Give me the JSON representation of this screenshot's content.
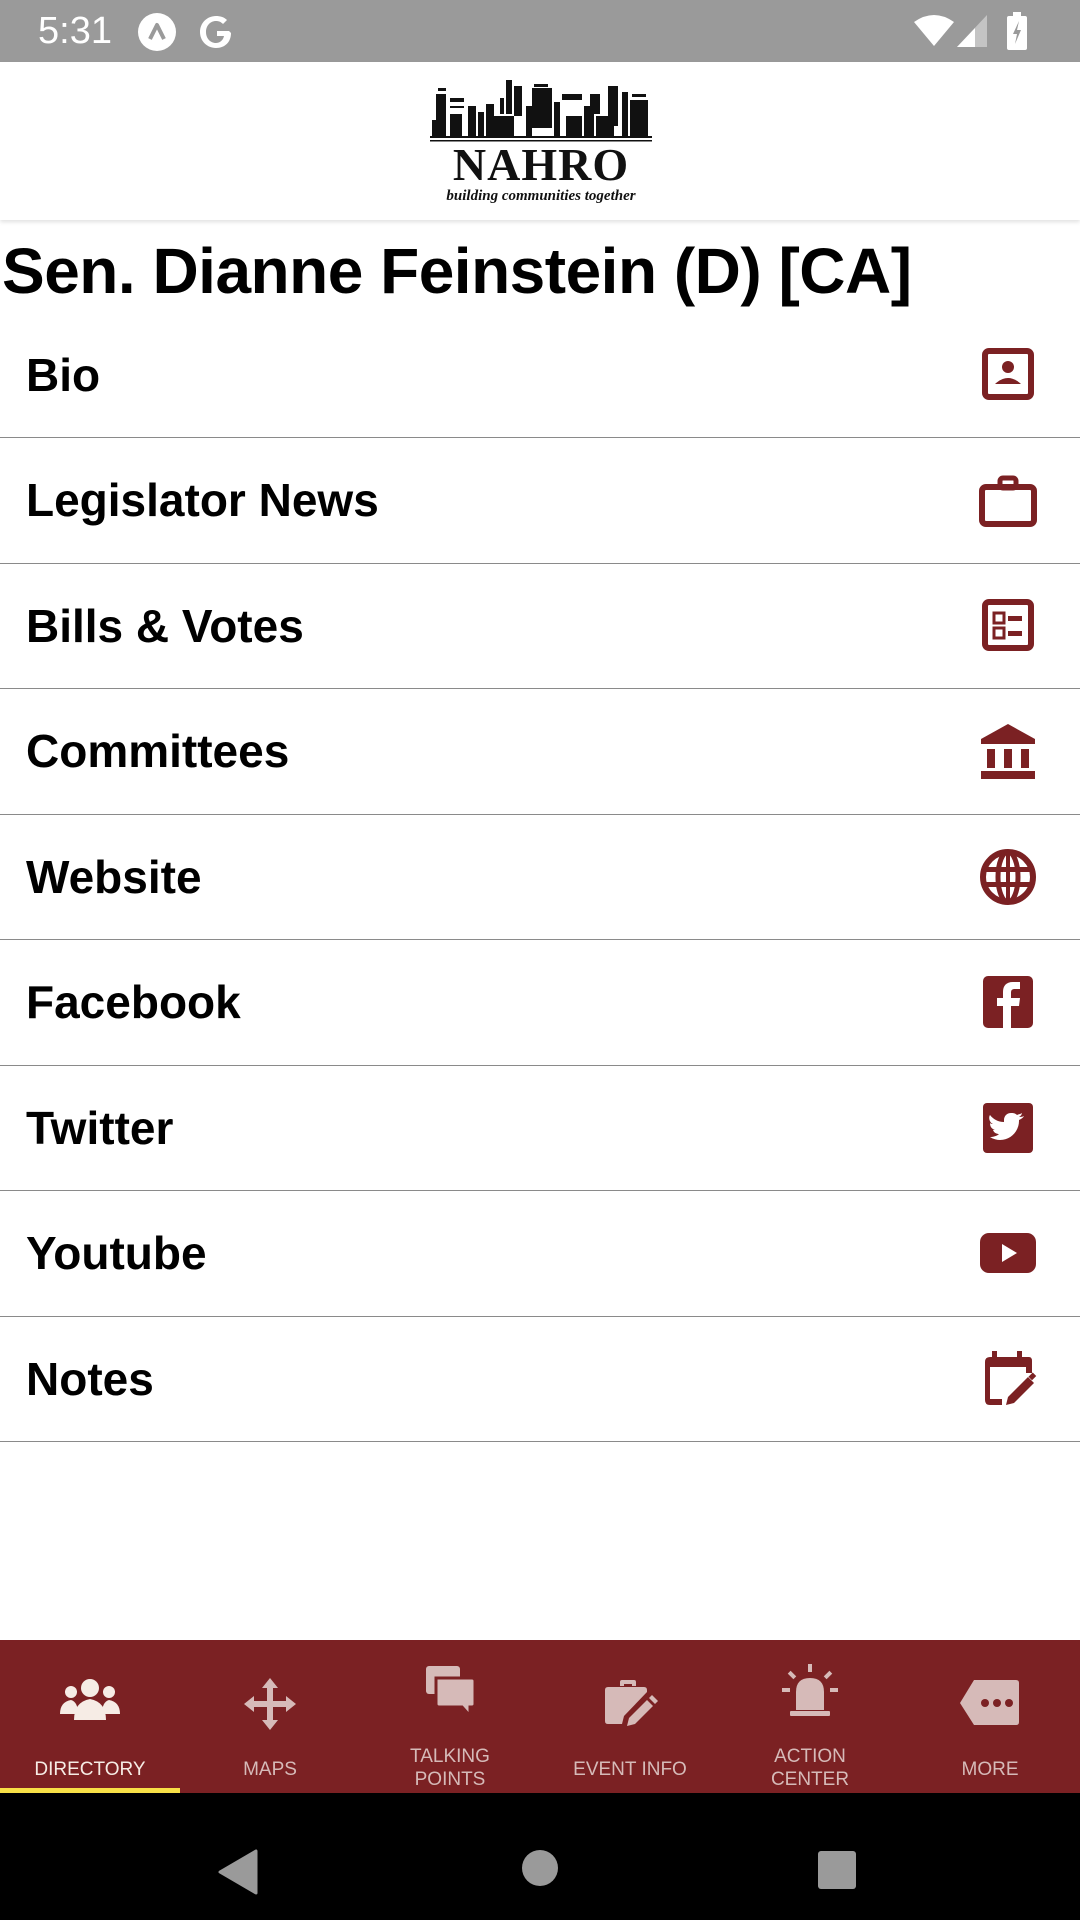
{
  "status_bar": {
    "time": "5:31",
    "icons": [
      "app-notification-icon",
      "google-icon",
      "wifi-icon",
      "cellular-signal-icon",
      "battery-charging-icon"
    ]
  },
  "header": {
    "logo_name": "NAHRO",
    "logo_tagline": "building communities together"
  },
  "page": {
    "title": "Sen. Dianne Feinstein (D) [CA]"
  },
  "menu": {
    "items": [
      {
        "label": "Bio",
        "icon": "contact-card-icon"
      },
      {
        "label": "Legislator News",
        "icon": "briefcase-icon"
      },
      {
        "label": "Bills & Votes",
        "icon": "checklist-icon"
      },
      {
        "label": "Committees",
        "icon": "government-building-icon"
      },
      {
        "label": "Website",
        "icon": "globe-icon"
      },
      {
        "label": "Facebook",
        "icon": "facebook-icon"
      },
      {
        "label": "Twitter",
        "icon": "twitter-icon"
      },
      {
        "label": "Youtube",
        "icon": "youtube-icon"
      },
      {
        "label": "Notes",
        "icon": "calendar-edit-icon"
      }
    ]
  },
  "bottom_nav": {
    "active_index": 0,
    "tabs": [
      {
        "line1": "DIRECTORY",
        "line2": "",
        "icon": "people-group-icon"
      },
      {
        "line1": "MAPS",
        "line2": "",
        "icon": "move-arrows-icon"
      },
      {
        "line1": "TALKING",
        "line2": "POINTS",
        "icon": "chat-bubbles-icon"
      },
      {
        "line1": "EVENT INFO",
        "line2": "",
        "icon": "briefcase-edit-icon"
      },
      {
        "line1": "ACTION",
        "line2": "CENTER",
        "icon": "alarm-light-icon"
      },
      {
        "line1": "MORE",
        "line2": "",
        "icon": "more-tag-icon"
      }
    ]
  },
  "colors": {
    "brand": "#7b2123",
    "active_indicator": "#f8e047",
    "status_bar": "#9a9a9a"
  }
}
